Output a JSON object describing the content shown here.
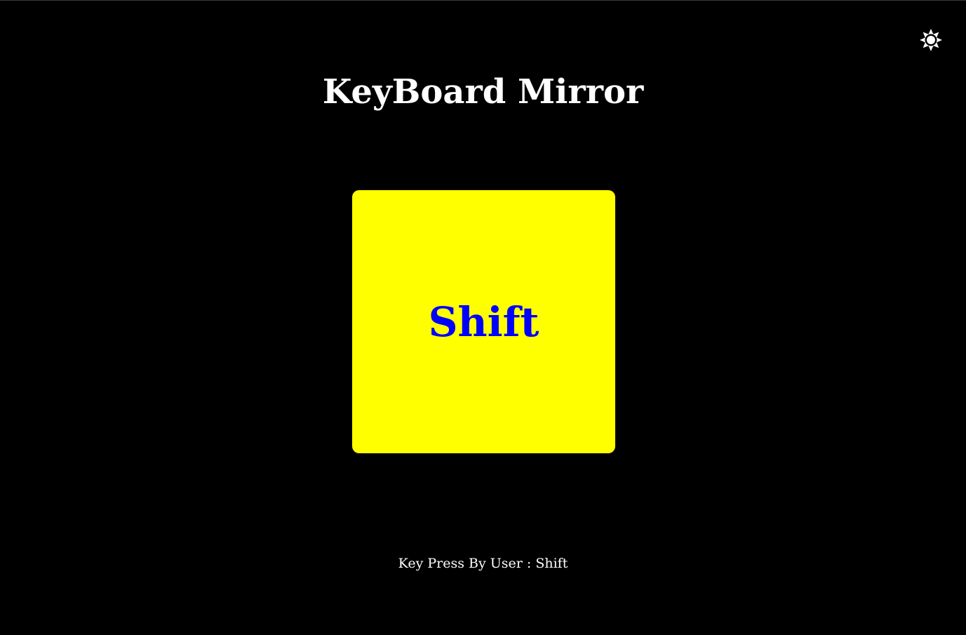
{
  "app": {
    "title": "KeyBoard Mirror"
  },
  "theme_toggle": {
    "icon": "sun-icon",
    "color": "#ffffff"
  },
  "key_display": {
    "key": "Shift",
    "box_color": "#ffff00",
    "text_color": "#0000ff"
  },
  "status": {
    "label": "Key Press By User : ",
    "key": "Shift"
  },
  "colors": {
    "background": "#000000",
    "text": "#ffffff"
  }
}
